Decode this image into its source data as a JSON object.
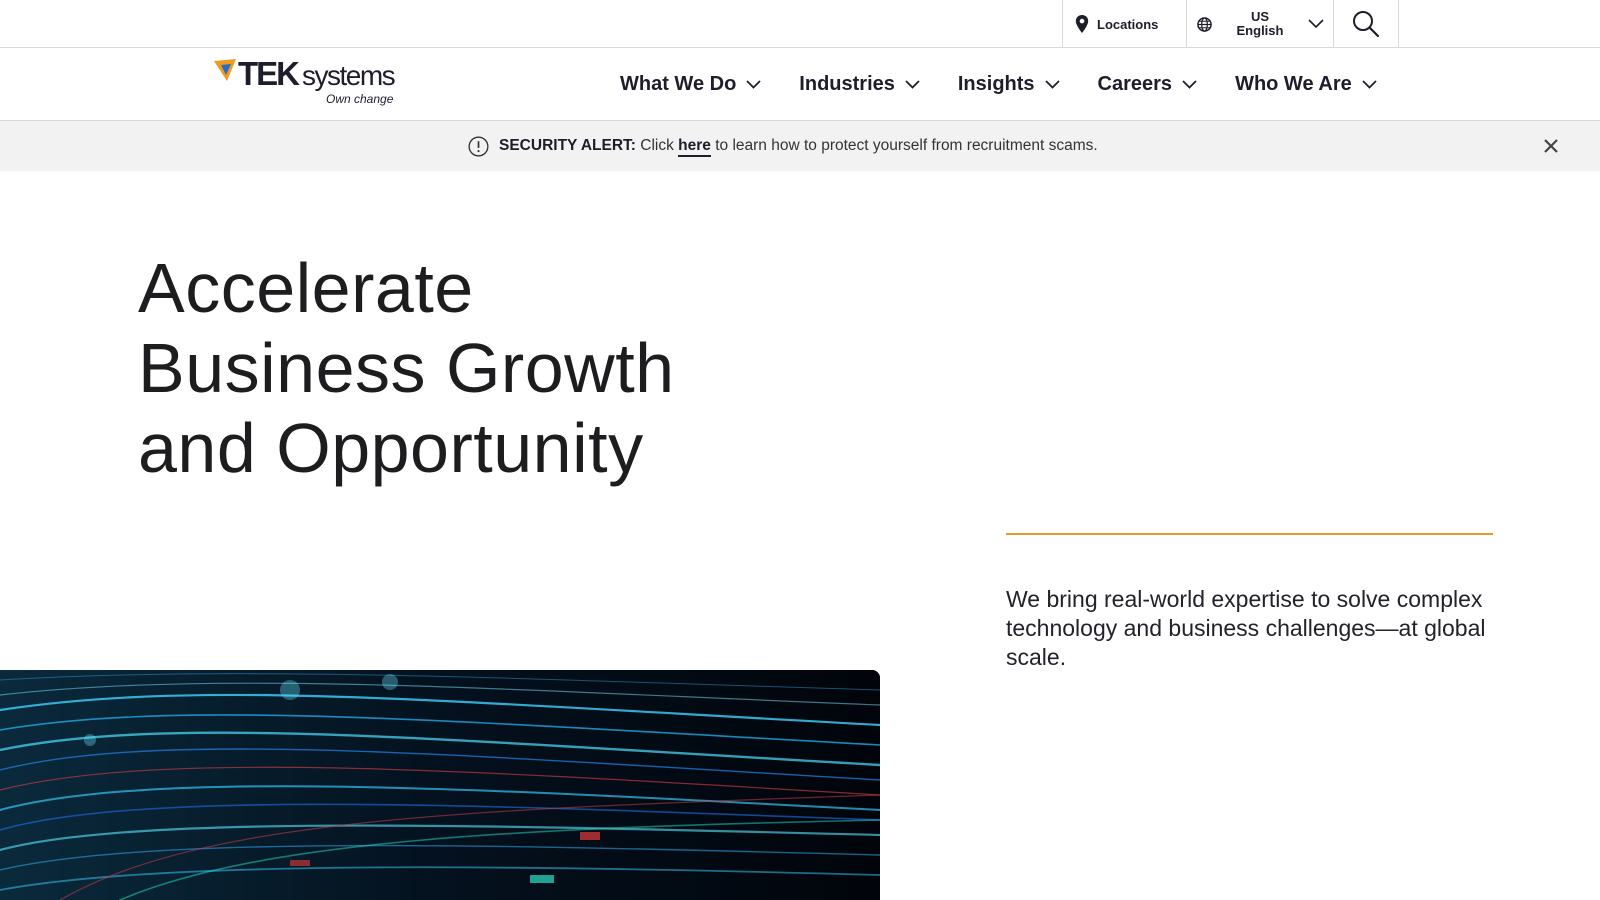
{
  "utility": {
    "locations_label": "Locations",
    "region": "US",
    "language": "English"
  },
  "brand": {
    "wordmark_bold": "TEK",
    "wordmark_light": "systems",
    "tagline": "Own change"
  },
  "nav": {
    "items": [
      {
        "label": "What We Do"
      },
      {
        "label": "Industries"
      },
      {
        "label": "Insights"
      },
      {
        "label": "Careers"
      },
      {
        "label": "Who We Are"
      }
    ]
  },
  "alert": {
    "title": "SECURITY ALERT:",
    "text_before": "Click",
    "link": "here",
    "text_after": "to learn how to protect yourself from recruitment scams."
  },
  "hero": {
    "title_lines": [
      "Accelerate",
      "Business Growth",
      "and Opportunity"
    ],
    "body": "We bring real-world expertise to solve complex technology and business challenges—at global scale."
  },
  "colors": {
    "accent": "#e29b2b",
    "text_dark": "#1d1d2b",
    "alert_bg": "#f2f2f2",
    "logo_orange": "#f29a1d",
    "logo_blue": "#1f6fc5"
  },
  "icons": {
    "locations": "map-pin-icon",
    "language": "globe-icon",
    "language_toggle": "chevron-down-icon",
    "search": "search-icon",
    "nav_toggle": "chevron-down-icon",
    "alert": "exclamation-circle-icon",
    "close": "close-icon"
  }
}
